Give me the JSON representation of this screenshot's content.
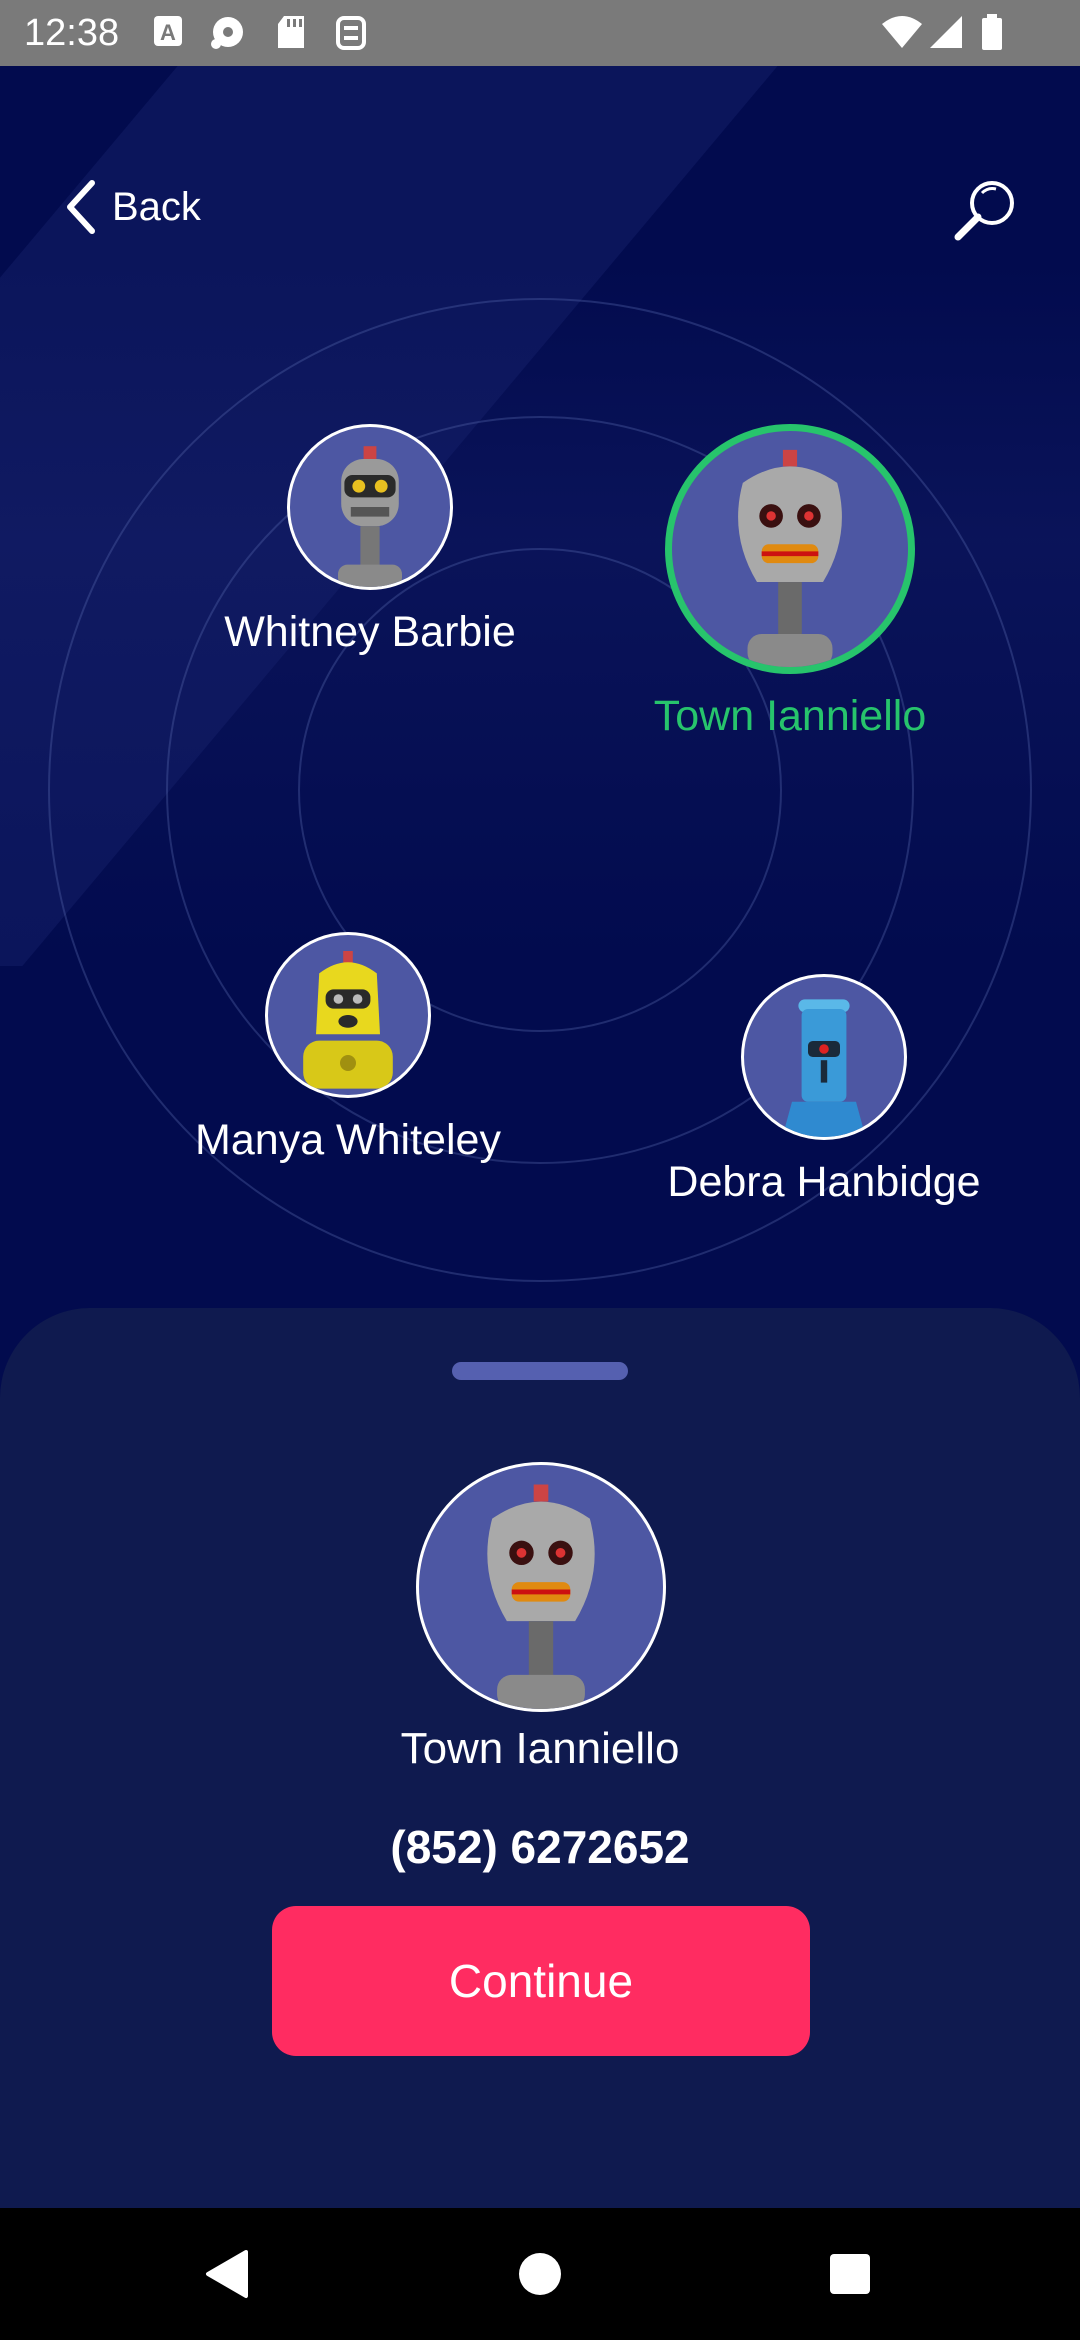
{
  "status_bar": {
    "time": "12:38",
    "icons": [
      "a-notification-icon",
      "media-icon",
      "sd-card-icon",
      "sync-icon",
      "wifi-icon",
      "signal-icon",
      "battery-icon"
    ]
  },
  "header": {
    "back_label": "Back",
    "search_icon": "search-icon"
  },
  "contacts": [
    {
      "name": "Whitney Barbie",
      "avatar": "gray-robot",
      "selected": false
    },
    {
      "name": "Town Ianniello",
      "avatar": "silver-robot",
      "selected": true
    },
    {
      "name": "Manya Whiteley",
      "avatar": "yellow-robot",
      "selected": false
    },
    {
      "name": "Debra Hanbidge",
      "avatar": "blue-robot",
      "selected": false
    }
  ],
  "sheet": {
    "name": "Town Ianniello",
    "phone": "(852) 6272652",
    "continue_label": "Continue"
  },
  "colors": {
    "background": "#020b4e",
    "sheet": "#0f1a4f",
    "accent_selected": "#27c46c",
    "button": "#ff2c61",
    "avatar_bg": "#4d57a3"
  },
  "nav_bar": {
    "icons": [
      "back-nav-icon",
      "home-nav-icon",
      "recents-nav-icon"
    ]
  }
}
